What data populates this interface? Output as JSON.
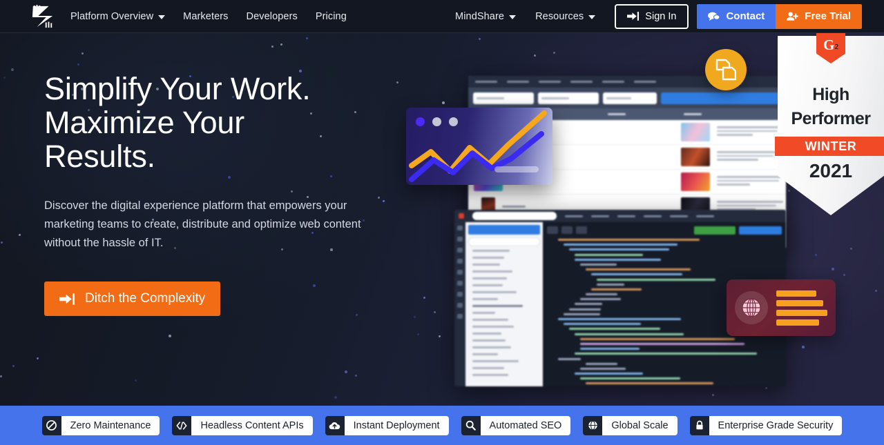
{
  "nav": {
    "logo_icon": "zesty-arrow-logo",
    "left_items": [
      {
        "label": "Platform Overview",
        "has_caret": true
      },
      {
        "label": "Marketers",
        "has_caret": false
      },
      {
        "label": "Developers",
        "has_caret": false
      },
      {
        "label": "Pricing",
        "has_caret": false
      }
    ],
    "right_items": [
      {
        "label": "MindShare",
        "has_caret": true
      },
      {
        "label": "Resources",
        "has_caret": true
      }
    ],
    "sign_in": {
      "label": "Sign In",
      "icon": "sign-in-arrow-icon"
    },
    "contact": {
      "label": "Contact",
      "icon": "chat-bubble-icon",
      "color": "#4573ec"
    },
    "free_trial": {
      "label": "Free Trial",
      "icon": "add-user-icon",
      "color": "#f26c15"
    }
  },
  "hero": {
    "title_line1": "Simplify Your Work.",
    "title_line2": "Maximize Your",
    "title_line3": "Results.",
    "subtitle": "Discover the digital experience platform that empowers your marketing teams to create, distribute and optimize web content without the hassle of IT.",
    "cta": {
      "label": "Ditch the Complexity",
      "icon": "sign-in-arrow-icon",
      "color": "#f26c15"
    }
  },
  "badge": {
    "logo_text": "G",
    "logo_sup": "2",
    "title_line1": "High",
    "title_line2": "Performer",
    "ribbon": "WINTER",
    "year": "2021",
    "ribbon_color": "#f04a26"
  },
  "collage": {
    "circle_badge_icon": "copy-documents-icon",
    "red_card": {
      "icon": "globe-icon",
      "bar_count": 4,
      "bar_color": "#f5a01f"
    },
    "chart_card": {
      "dot_colors": [
        "#4e28f5",
        "#c3c6d6",
        "#c3c6d6"
      ],
      "line_colors": [
        "#f5a81e",
        "#3b2af0"
      ]
    }
  },
  "chart_data": {
    "type": "line",
    "title": "",
    "x": [
      0,
      1,
      2,
      3,
      4,
      5,
      6
    ],
    "series": [
      {
        "name": "orange-trend",
        "color": "#f5a81e",
        "values": [
          34,
          20,
          56,
          36,
          54,
          80,
          118
        ]
      },
      {
        "name": "blue-trend",
        "color": "#3b2af0",
        "values": [
          10,
          36,
          22,
          46,
          30,
          50,
          78
        ]
      }
    ],
    "xlabel": "",
    "ylabel": "",
    "legend": "none",
    "grid": false
  },
  "features": {
    "items": [
      {
        "icon": "no-entry-icon",
        "label": "Zero Maintenance"
      },
      {
        "icon": "code-brackets-icon",
        "label": "Headless Content APIs"
      },
      {
        "icon": "cloud-upload-icon",
        "label": "Instant Deployment"
      },
      {
        "icon": "search-icon",
        "label": "Automated SEO"
      },
      {
        "icon": "globe-icon",
        "label": "Global Scale"
      },
      {
        "icon": "lock-icon",
        "label": "Enterprise Grade Security"
      }
    ],
    "bar_color": "#4573ec"
  }
}
